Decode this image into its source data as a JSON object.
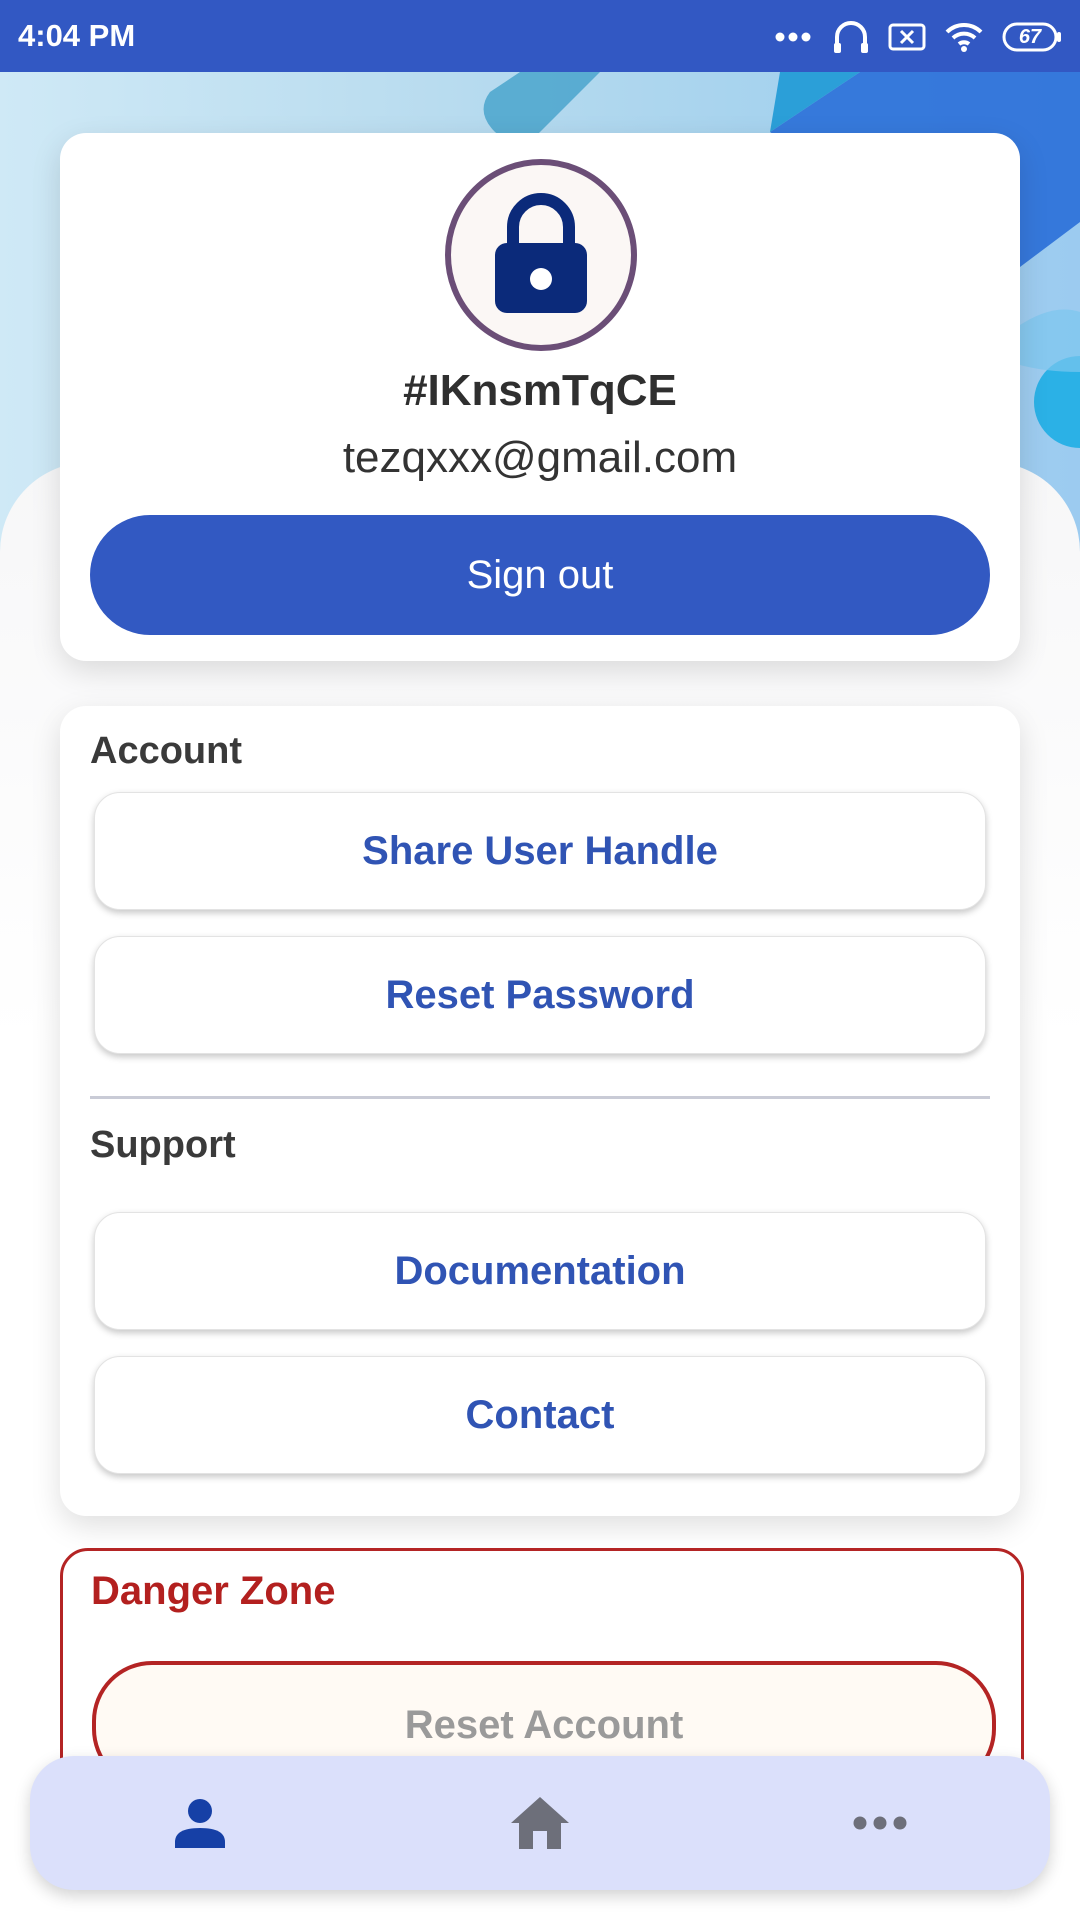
{
  "status_bar": {
    "time": "4:04 PM",
    "battery": "67"
  },
  "profile": {
    "handle": "#IKnsmTqCE",
    "email": "tezqxxx@gmail.com",
    "sign_out_label": "Sign out",
    "avatar_icon": "lock-icon"
  },
  "account": {
    "title": "Account",
    "items": [
      {
        "label": "Share User Handle"
      },
      {
        "label": "Reset Password"
      }
    ]
  },
  "support": {
    "title": "Support",
    "items": [
      {
        "label": "Documentation"
      },
      {
        "label": "Contact"
      }
    ]
  },
  "danger_zone": {
    "title": "Danger Zone",
    "reset_label": "Reset Account"
  },
  "bottom_nav": {
    "items": [
      {
        "icon": "person-icon",
        "active": true
      },
      {
        "icon": "home-icon",
        "active": false
      },
      {
        "icon": "more-icon",
        "active": false
      }
    ]
  },
  "colors": {
    "primary": "#3259c2",
    "danger": "#b42424",
    "nav_bg": "#dbe0fb",
    "avatar_ring": "#6b4e77",
    "lock_fill": "#0b2a7a"
  }
}
